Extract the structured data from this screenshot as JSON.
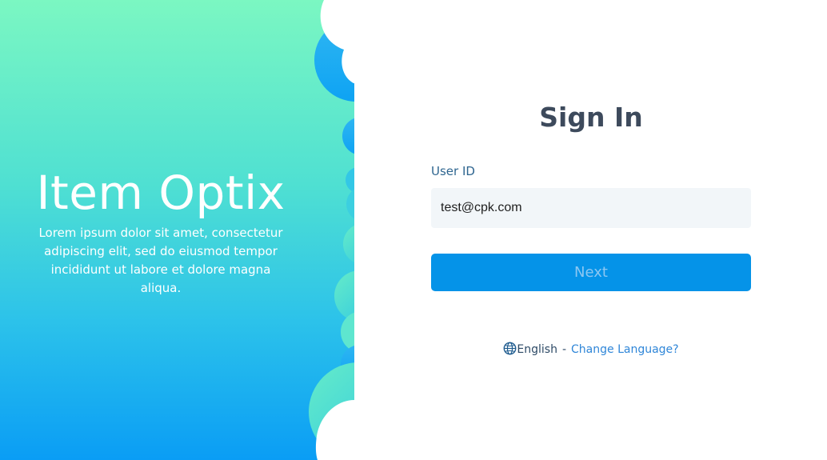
{
  "hero": {
    "brand_name": "Item Optix",
    "tagline": "Lorem ipsum dolor sit amet, consectetur adipiscing elit, sed do eiusmod tempor incididunt ut labore et dolore magna aliqua."
  },
  "login": {
    "title": "Sign In",
    "user_id_label": "User ID",
    "user_id_value": "test@cpk.com",
    "next_label": "Next"
  },
  "language": {
    "icon": "globe-icon",
    "current": "English",
    "separator": "-",
    "change_label": "Change Language?"
  },
  "colors": {
    "hero_gradient_top": "#7bf7c2",
    "hero_gradient_bottom": "#0a9df5",
    "title": "#3d4a5c",
    "label": "#2f6690",
    "input_bg": "#f2f6f9",
    "button_bg": "#0593e8",
    "button_text": "#8cc7f2",
    "link": "#2f86d8"
  }
}
